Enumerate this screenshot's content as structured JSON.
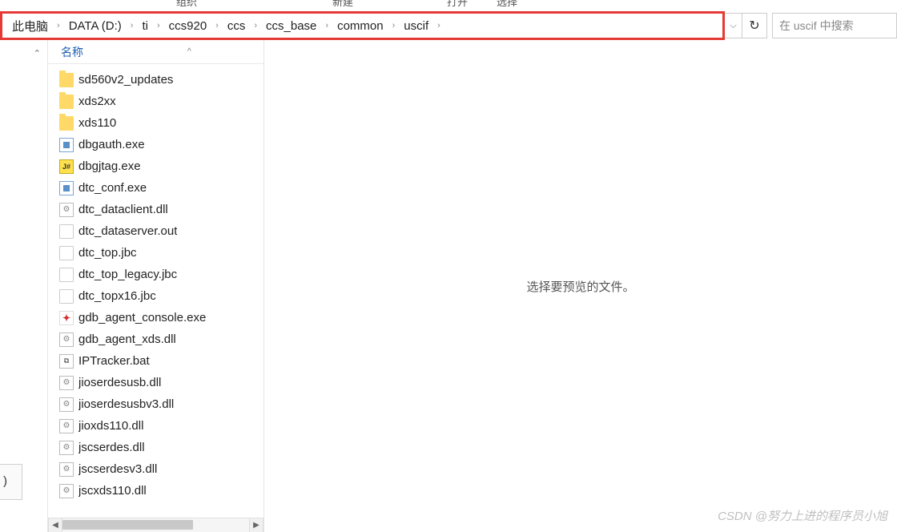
{
  "ribbon_hints": {
    "t1": "组织",
    "t2": "新建",
    "t3": "打开",
    "t4": "选择"
  },
  "breadcrumb": [
    {
      "label": "此电脑"
    },
    {
      "label": "DATA (D:)"
    },
    {
      "label": "ti"
    },
    {
      "label": "ccs920"
    },
    {
      "label": "ccs"
    },
    {
      "label": "ccs_base"
    },
    {
      "label": "common"
    },
    {
      "label": "uscif"
    }
  ],
  "search": {
    "placeholder": "在 uscif 中搜索"
  },
  "column_header": {
    "name": "名称",
    "sort_indicator": "^"
  },
  "files": [
    {
      "name": "sd560v2_updates",
      "type": "folder"
    },
    {
      "name": "xds2xx",
      "type": "folder"
    },
    {
      "name": "xds110",
      "type": "folder"
    },
    {
      "name": "dbgauth.exe",
      "type": "exe-blue"
    },
    {
      "name": "dbgjtag.exe",
      "type": "exe-yellow"
    },
    {
      "name": "dtc_conf.exe",
      "type": "exe-blue"
    },
    {
      "name": "dtc_dataclient.dll",
      "type": "dll"
    },
    {
      "name": "dtc_dataserver.out",
      "type": "file"
    },
    {
      "name": "dtc_top.jbc",
      "type": "file"
    },
    {
      "name": "dtc_top_legacy.jbc",
      "type": "file"
    },
    {
      "name": "dtc_topx16.jbc",
      "type": "file"
    },
    {
      "name": "gdb_agent_console.exe",
      "type": "exe-red"
    },
    {
      "name": "gdb_agent_xds.dll",
      "type": "dll"
    },
    {
      "name": "IPTracker.bat",
      "type": "bat"
    },
    {
      "name": "jioserdesusb.dll",
      "type": "dll"
    },
    {
      "name": "jioserdesusbv3.dll",
      "type": "dll"
    },
    {
      "name": "jioxds110.dll",
      "type": "dll"
    },
    {
      "name": "jscserdes.dll",
      "type": "dll"
    },
    {
      "name": "jscserdesv3.dll",
      "type": "dll"
    },
    {
      "name": "jscxds110.dll",
      "type": "dll"
    }
  ],
  "preview": {
    "empty_text": "选择要预览的文件。"
  },
  "watermark": "CSDN @努力上进的程序员小旭",
  "nav_paren": ")"
}
